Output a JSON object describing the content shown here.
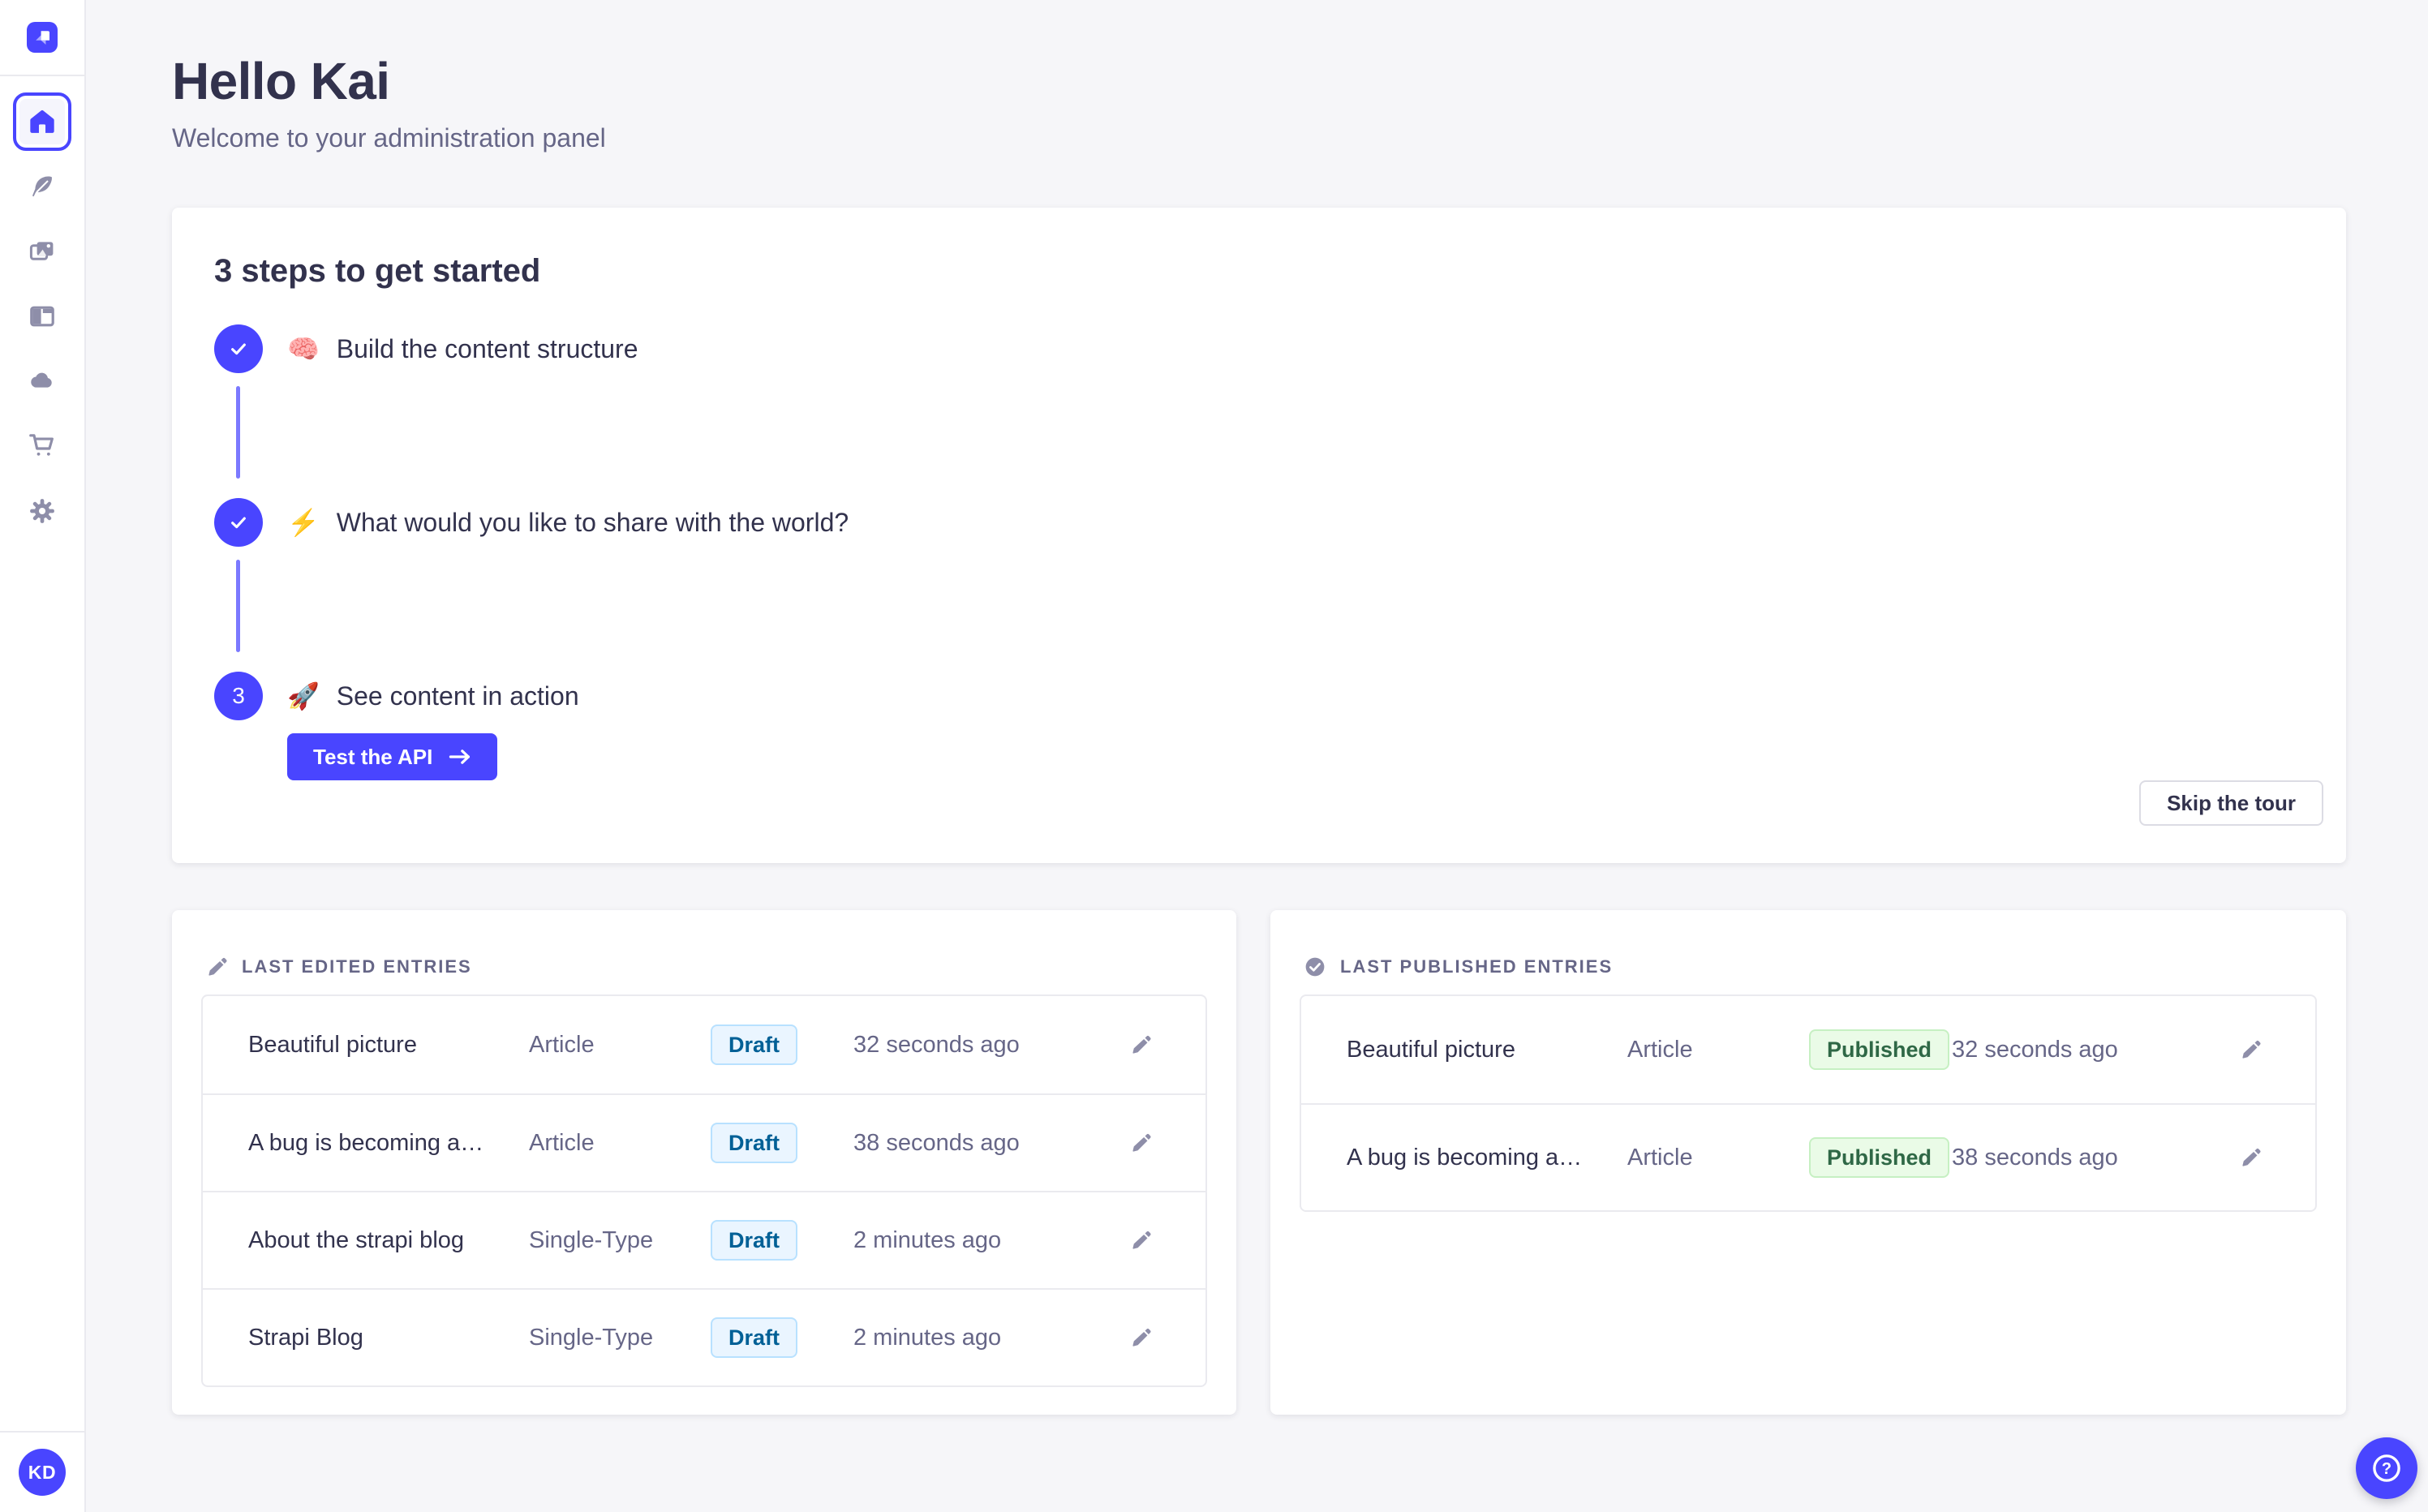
{
  "header": {
    "title": "Hello Kai",
    "subtitle": "Welcome to your administration panel"
  },
  "sidebar": {
    "logo": "strapi-logo",
    "items": [
      {
        "name": "home",
        "icon": "home-icon",
        "active": true
      },
      {
        "name": "content-manager",
        "icon": "feather-icon",
        "active": false
      },
      {
        "name": "media-library",
        "icon": "images-icon",
        "active": false
      },
      {
        "name": "content-type-builder",
        "icon": "layout-icon",
        "active": false
      },
      {
        "name": "cloud",
        "icon": "cloud-icon",
        "active": false
      },
      {
        "name": "marketplace",
        "icon": "cart-icon",
        "active": false
      },
      {
        "name": "settings",
        "icon": "gear-icon",
        "active": false
      }
    ],
    "avatar": {
      "initials": "KD"
    }
  },
  "onboarding": {
    "title": "3 steps to get started",
    "steps": [
      {
        "emoji": "🧠",
        "label": "Build the content structure",
        "status": "done"
      },
      {
        "emoji": "⚡",
        "label": "What would you like to share with the world?",
        "status": "done"
      },
      {
        "emoji": "🚀",
        "label": "See content in action",
        "status": "todo",
        "number": "3",
        "cta_label": "Test the API"
      }
    ],
    "skip_label": "Skip the tour"
  },
  "entries": {
    "last_edited": {
      "title": "LAST EDITED ENTRIES",
      "icon": "pencil-icon",
      "rows": [
        {
          "title": "Beautiful picture",
          "type": "Article",
          "status": "Draft",
          "time": "32 seconds ago"
        },
        {
          "title": "A bug is becoming a…",
          "type": "Article",
          "status": "Draft",
          "time": "38 seconds ago"
        },
        {
          "title": "About the strapi blog",
          "type": "Single-Type",
          "status": "Draft",
          "time": "2 minutes ago"
        },
        {
          "title": "Strapi Blog",
          "type": "Single-Type",
          "status": "Draft",
          "time": "2 minutes ago"
        }
      ]
    },
    "last_published": {
      "title": "LAST PUBLISHED ENTRIES",
      "icon": "check-circle-icon",
      "rows": [
        {
          "title": "Beautiful picture",
          "type": "Article",
          "status": "Published",
          "time": "32 seconds ago"
        },
        {
          "title": "A bug is becoming a…",
          "type": "Article",
          "status": "Published",
          "time": "38 seconds ago"
        }
      ]
    }
  },
  "colors": {
    "primary": "#4945ff",
    "background": "#f6f6f9",
    "text": "#32324d",
    "text_secondary": "#666687",
    "connector": "#7b79ff",
    "icon_gray": "#8e8ea9",
    "draft_text": "#006096",
    "draft_bg": "#eaf5ff",
    "draft_border": "#b8e1ff",
    "published_text": "#2f6846",
    "published_bg": "#eafbe7",
    "published_border": "#c6f0c2"
  }
}
